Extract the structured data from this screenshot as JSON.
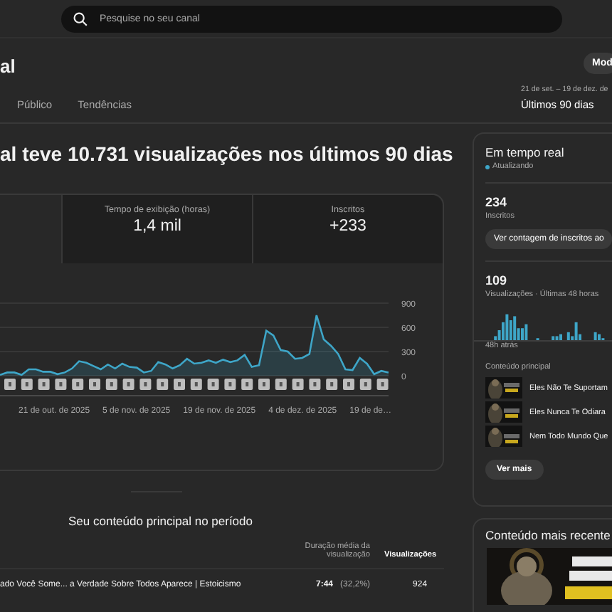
{
  "search": {
    "placeholder": "Pesquise no seu canal"
  },
  "header": {
    "title": "al",
    "button": "Mod",
    "date_range": "21 de set. – 19 de dez. de",
    "period": "Últimos 90 dias"
  },
  "tabs": [
    {
      "label": "Público",
      "selected": false
    },
    {
      "label": "Tendências",
      "selected": false
    }
  ],
  "headline": "al teve 10.731 visualizações nos últimos 90 dias",
  "metrics": [
    {
      "label": "Tempo de exibição (horas)",
      "value": "1,4 mil"
    },
    {
      "label": "Inscritos",
      "value": "+233"
    }
  ],
  "chart": {
    "date_labels": [
      "21 de out. de 2025",
      "5 de nov. de 2025",
      "19 de nov. de 2025",
      "4 de dez. de 2025",
      "19 de de…"
    ],
    "chart_data": {
      "type": "area",
      "yticks": [
        0,
        300,
        600,
        900
      ],
      "ylim": [
        0,
        900
      ],
      "series": [
        {
          "color": "#3ea6c8",
          "values": [
            10,
            40,
            40,
            10,
            80,
            80,
            50,
            50,
            20,
            40,
            90,
            180,
            160,
            120,
            80,
            140,
            90,
            150,
            110,
            100,
            40,
            60,
            170,
            140,
            90,
            130,
            210,
            150,
            160,
            190,
            160,
            200,
            170,
            190,
            260,
            110,
            130,
            560,
            500,
            320,
            300,
            210,
            220,
            270,
            750,
            450,
            370,
            270,
            80,
            70,
            220,
            150,
            20,
            60,
            40
          ]
        }
      ]
    }
  },
  "realtime": {
    "title": "Em tempo real",
    "status": "Atualizando",
    "subscribers": "234",
    "subscribers_label": "Inscritos",
    "count_button": "Ver contagem de inscritos ao",
    "views": "109",
    "views_label": "Visualizações · Últimas 48 horas",
    "since": "48h atrás",
    "top_label": "Conteúdo principal",
    "items": [
      {
        "title": "Eles Não Te Suportam"
      },
      {
        "title": "Eles Nunca Te Odiara"
      },
      {
        "title": "Nem Todo Mundo Que"
      }
    ],
    "more_button": "Ver mais"
  },
  "top_content": {
    "title": "Seu conteúdo principal no período",
    "columns": [
      "Duração média da visualização",
      "Visualizações"
    ],
    "rows": [
      {
        "title": "ado Você Some... a Verdade Sobre Todos Aparece | Estoicismo",
        "duration": "7:44",
        "percent": "(32,2%)",
        "views": "924"
      }
    ]
  },
  "latest": {
    "title": "Conteúdo mais recente"
  }
}
